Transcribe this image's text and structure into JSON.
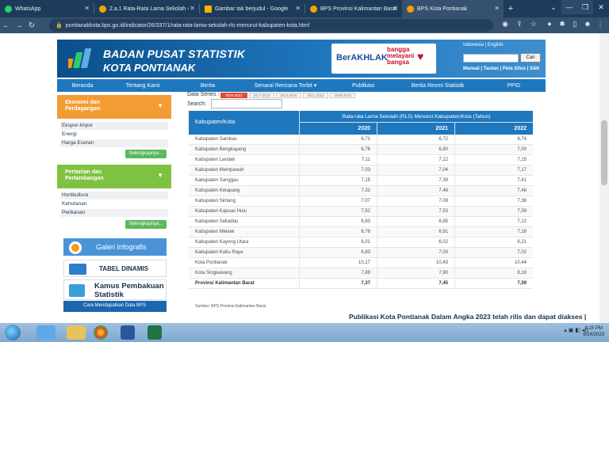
{
  "browser": {
    "tabs": [
      {
        "title": "WhatsApp",
        "color": "#25d366"
      },
      {
        "title": "2.a.1 Rata-Rata Lama Sekolah -",
        "color": "#f4a300"
      },
      {
        "title": "Gambar tak berjudul - Google",
        "color": "#f4b400"
      },
      {
        "title": "BPS Provinsi Kalimantan Barat",
        "color": "#f4a300"
      },
      {
        "title": "BPS Kota Pontianak",
        "color": "#f4a300"
      }
    ],
    "url": "pontianakkota.bps.go.id/indicator/26/337/1/rata-rata-lama-sekolah-rls-menurut-kabupaten-kota.html"
  },
  "header": {
    "brand_line1": "BADAN PUSAT STATISTIK",
    "brand_line2": "KOTA PONTIANAK",
    "akhlak_left": "BerAKHLAK",
    "akhlak_right1": "bangga",
    "akhlak_right2": "melayani",
    "akhlak_right3": "bangsa",
    "lang": "Indonesia | English",
    "search_button": "Cari",
    "quicklinks": "Manual | Tautan | Peta Situs | S&K"
  },
  "menu": [
    "Beranda",
    "Tentang Kami",
    "Berita",
    "Senarai Rencana Terbit ▾",
    "Publikasi",
    "Berita Resmi Statistik",
    "PPID"
  ],
  "sidebar": {
    "cat1": "Ekonomi dan Perdagangan",
    "cat1_items": [
      "Ekspor-Impor",
      "Energi",
      "Harga Eceran"
    ],
    "cat2": "Pertanian dan Pertambangan",
    "cat2_items": [
      "Hortikultura",
      "Kehutanan",
      "Perikanan"
    ],
    "more_label": "Selengkapnya...",
    "promo": {
      "infografis": "Galeri Infografis",
      "tabel": "TABEL DINAMIS",
      "kamus1": "Kamus Pembakuan",
      "kamus2": "Statistik",
      "cara": "Cara Mendapatkan Data BPS"
    }
  },
  "data_series": {
    "label": "Data Series :",
    "options": [
      "2020-2022",
      "2017-2019",
      "2014-2016",
      "2011-2013",
      "2008-2010"
    ]
  },
  "search_label": "Search:",
  "table": {
    "col_kab": "Kabupaten/Kota",
    "col_span": "Rata-rata Lama Sekolah (RLS) Menurut Kabupaten/Kota (Tahun)",
    "years": [
      "2020",
      "2021",
      "2022"
    ],
    "rows": [
      {
        "name": "Kabupaten Sambas",
        "v": [
          "6,71",
          "6,72",
          "6,74"
        ]
      },
      {
        "name": "Kabupaten Bengkayang",
        "v": [
          "6,76",
          "6,80",
          "7,00"
        ]
      },
      {
        "name": "Kabupaten Landak",
        "v": [
          "7,11",
          "7,12",
          "7,15"
        ]
      },
      {
        "name": "Kabupaten Mempawah",
        "v": [
          "7,03",
          "7,04",
          "7,17"
        ]
      },
      {
        "name": "Kabupaten Sanggau",
        "v": [
          "7,15",
          "7,39",
          "7,41"
        ]
      },
      {
        "name": "Kabupaten Ketapang",
        "v": [
          "7,31",
          "7,46",
          "7,48"
        ]
      },
      {
        "name": "Kabupaten Sintang",
        "v": [
          "7,07",
          "7,08",
          "7,36"
        ]
      },
      {
        "name": "Kabupaten Kapuas Hulu",
        "v": [
          "7,52",
          "7,53",
          "7,59"
        ]
      },
      {
        "name": "Kabupaten Sekadau",
        "v": [
          "6,83",
          "6,85",
          "7,12"
        ]
      },
      {
        "name": "Kabupaten Melawi",
        "v": [
          "6,76",
          "6,91",
          "7,18"
        ]
      },
      {
        "name": "Kabupaten Kayong Utara",
        "v": [
          "6,01",
          "6,02",
          "6,21"
        ]
      },
      {
        "name": "Kabupaten Kubu Raya",
        "v": [
          "6,83",
          "7,00",
          "7,02"
        ]
      },
      {
        "name": "Kota Pontianak",
        "v": [
          "10,17",
          "10,43",
          "10,44"
        ]
      },
      {
        "name": "Kota Singkawang",
        "v": [
          "7,89",
          "7,90",
          "8,19"
        ]
      },
      {
        "name": "Provinsi Kalimantan Barat",
        "v": [
          "7,37",
          "7,45",
          "7,59"
        ]
      }
    ],
    "source": "Sumber: BPS Provinsi Kalimantan Barat"
  },
  "ticker": "Publikasi Kota Pontianak Dalam Angka 2023 telah rilis dan dapat diakses |",
  "taskbar": {
    "time": "3:15 PM",
    "date": "6/14/2023"
  }
}
